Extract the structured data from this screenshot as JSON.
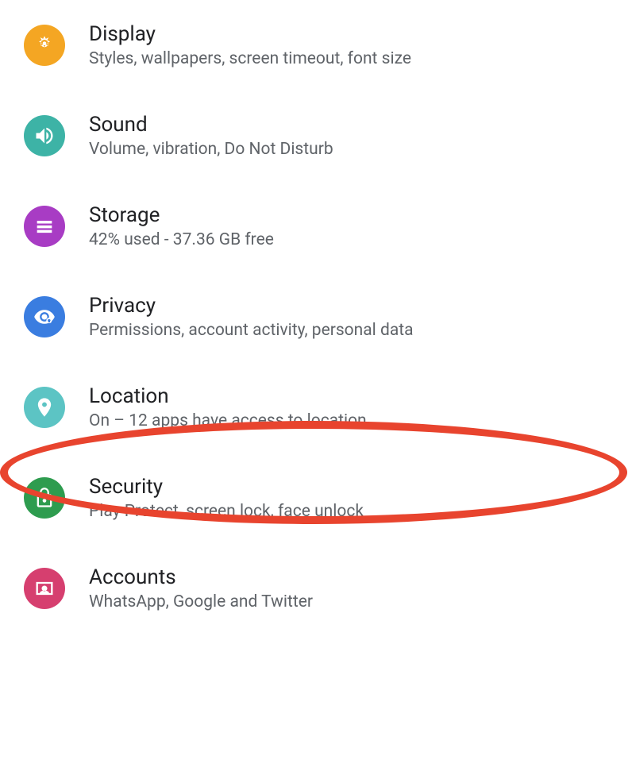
{
  "settings": {
    "items": [
      {
        "id": "display",
        "title": "Display",
        "subtitle": "Styles, wallpapers, screen timeout, font size",
        "iconColor": "#f4a623",
        "highlighted": false
      },
      {
        "id": "sound",
        "title": "Sound",
        "subtitle": "Volume, vibration, Do Not Disturb",
        "iconColor": "#3db3a6",
        "highlighted": false
      },
      {
        "id": "storage",
        "title": "Storage",
        "subtitle": "42% used - 37.36 GB free",
        "iconColor": "#a83cc4",
        "highlighted": false
      },
      {
        "id": "privacy",
        "title": "Privacy",
        "subtitle": "Permissions, account activity, personal data",
        "iconColor": "#3a7de0",
        "highlighted": false
      },
      {
        "id": "location",
        "title": "Location",
        "subtitle": "On – 12 apps have access to location",
        "iconColor": "#5cc4c4",
        "highlighted": true
      },
      {
        "id": "security",
        "title": "Security",
        "subtitle": "Play Protect, screen lock, face unlock",
        "iconColor": "#2e9c4f",
        "highlighted": false
      },
      {
        "id": "accounts",
        "title": "Accounts",
        "subtitle": "WhatsApp, Google and Twitter",
        "iconColor": "#d63f6f",
        "highlighted": false
      }
    ]
  }
}
